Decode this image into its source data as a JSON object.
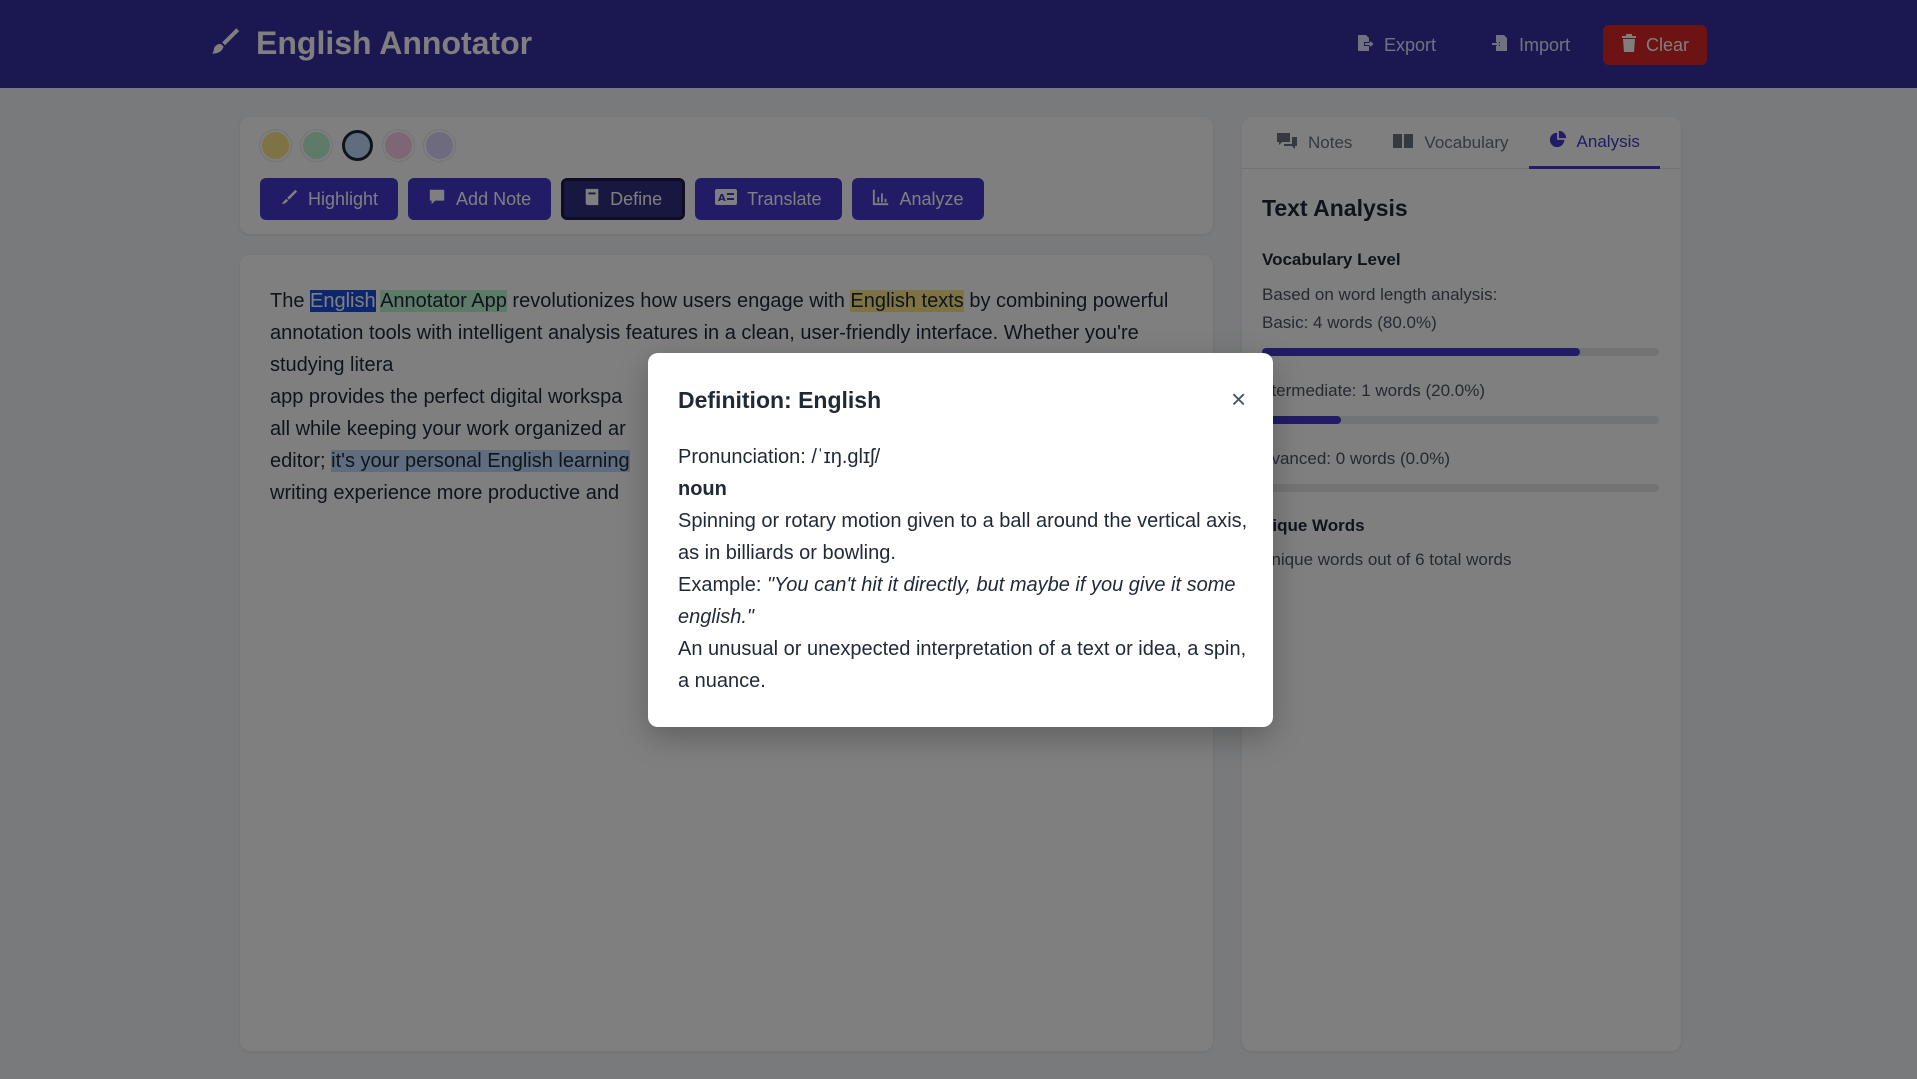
{
  "app": {
    "title": "English Annotator",
    "header_buttons": {
      "export": "Export",
      "import": "Import",
      "clear": "Clear"
    }
  },
  "colors": {
    "header": "#3730a3",
    "accent": "#4338ca",
    "danger": "#dc2626",
    "swatches": [
      "#fde68a",
      "#bbf7d0",
      "#bfdbfe",
      "#fbcfe8",
      "#ddd6fe"
    ],
    "selected_swatch": "#bfdbfe"
  },
  "toolbar": {
    "highlight": "Highlight",
    "add_note": "Add Note",
    "define": "Define",
    "translate": "Translate",
    "analyze": "Analyze",
    "active_tool": "Define"
  },
  "editor": {
    "seg1": "The ",
    "seg2": "English",
    "seg3": " ",
    "seg4": "Annotator App",
    "seg5": " revolutionizes how users engage with ",
    "seg6": "English texts",
    "seg7": " by combining powerful annotation tools with intelligent analysis features in a clean, user-friendly interface. Whether you're studying litera",
    "seg8": "app provides the perfect digital workspa",
    "seg9": "all while keeping your work organized ar",
    "seg10": "editor; ",
    "seg11": "it's your personal English learning",
    "seg12": "writing experience more productive and"
  },
  "sidebar": {
    "tabs": [
      "Notes",
      "Vocabulary",
      "Analysis"
    ],
    "active_tab": "Analysis",
    "heading": "Text Analysis",
    "vocab_title": "Vocabulary Level",
    "vocab_intro": "Based on word length analysis:",
    "levels": [
      {
        "label": "Basic: 4 words (80.0%)",
        "percent": 80
      },
      {
        "label": "ntermediate: 1 words (20.0%)",
        "percent": 20
      },
      {
        "label": "dvanced: 0 words (0.0%)",
        "percent": 0
      }
    ],
    "unique_title": "nique Words",
    "unique_text": " unique words out of 6 total words"
  },
  "modal": {
    "title": "Definition: English",
    "close": "×",
    "pronunciation": "Pronunciation: /ˈɪŋ.ɡlɪʃ/",
    "part_of_speech": "noun",
    "definition1": "Spinning or rotary motion given to a ball around the vertical axis, as in billiards or bowling.",
    "example_label": "Example: ",
    "example": "\"You can't hit it directly, but maybe if you give it some english.\"",
    "definition2": "An unusual or unexpected interpretation of a text or idea, a spin, a nuance."
  },
  "icons": {
    "brand": "brush-icon",
    "export": "file-export-icon",
    "import": "file-import-icon",
    "clear": "trash-icon",
    "highlight": "highlighter-icon",
    "add_note": "comment-icon",
    "define": "book-icon",
    "translate": "language-icon",
    "analyze": "chart-icon",
    "notes": "comments-icon",
    "vocabulary": "book-open-icon",
    "analysis": "pie-chart-icon"
  }
}
